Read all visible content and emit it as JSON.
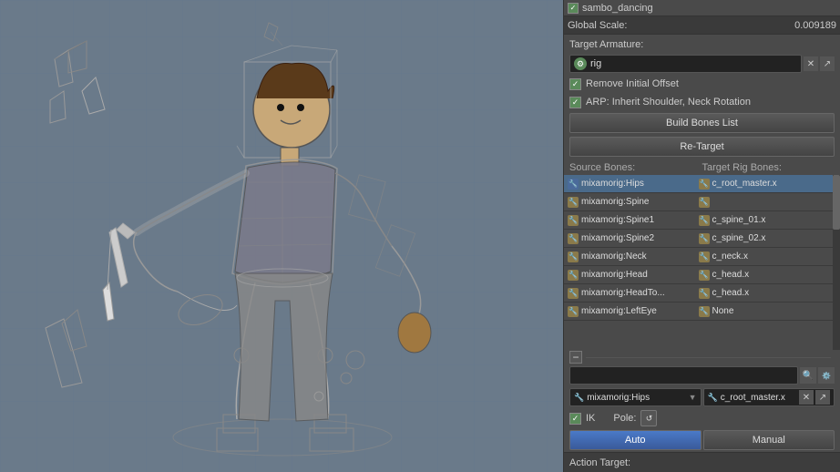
{
  "viewport": {
    "background_color": "#6a7a8a",
    "label": "3D Viewport"
  },
  "right_panel": {
    "sambo_label": "sambo_dancing",
    "global_scale_label": "Global Scale:",
    "global_scale_value": "0.009189",
    "target_armature_label": "Target Armature:",
    "rig_value": "rig",
    "remove_initial_offset_label": "Remove Initial Offset",
    "arp_inherit_label": "ARP: Inherit Shoulder, Neck Rotation",
    "build_bones_label": "Build Bones List",
    "retarget_label": "Re-Target",
    "source_bones_label": "Source Bones:",
    "target_rig_bones_label": "Target Rig Bones:",
    "bones": [
      {
        "source": "mixamorig:Hips",
        "target": "c_root_master.x",
        "selected": true
      },
      {
        "source": "mixamorig:Spine",
        "target": "",
        "selected": false
      },
      {
        "source": "mixamorig:Spine1",
        "target": "c_spine_01.x",
        "selected": false
      },
      {
        "source": "mixamorig:Spine2",
        "target": "c_spine_02.x",
        "selected": false
      },
      {
        "source": "mixamorig:Neck",
        "target": "c_neck.x",
        "selected": false
      },
      {
        "source": "mixamorig:Head",
        "target": "c_head.x",
        "selected": false
      },
      {
        "source": "mixamorig:HeadTo...",
        "target": "c_head.x",
        "selected": false
      },
      {
        "source": "mixamorig:LeftEye",
        "target": "None",
        "selected": false
      }
    ],
    "source_dropdown_value": "mixamorig:Hips",
    "target_dropdown_value": "c_root_master.x",
    "ik_label": "IK",
    "pole_label": "Pole:",
    "auto_label": "Auto",
    "manual_label": "Manual",
    "action_target_label": "Action Target:"
  }
}
